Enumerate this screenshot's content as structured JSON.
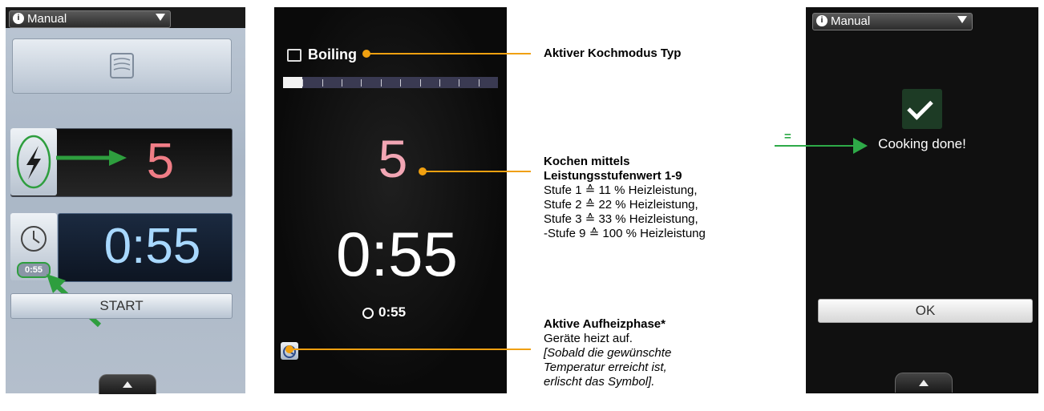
{
  "screen1": {
    "mode_dropdown": {
      "label": "Manual",
      "icon": "info-icon"
    },
    "mode_button_icon": "boiling-mode-icon",
    "power_icon": "lightning-bolt-icon",
    "power_value": "5",
    "clock_icon": "clock-icon",
    "time_value": "0:55",
    "small_time": "0:55",
    "start_label": "START",
    "bottom_tab_icon": "chevron-up-icon"
  },
  "screen2": {
    "mode_label": "Boiling",
    "mode_icon": "boiling-mode-icon",
    "progress_fraction": 0.09,
    "power_value": "5",
    "time_value": "0:55",
    "small_time": "0:55",
    "heat_icon": "heating-phase-icon"
  },
  "annotations": {
    "mode_type": "Aktiver Kochmodus Typ",
    "power_title_1": "Kochen mittels",
    "power_title_2": "Leistungsstufenwert 1-9",
    "power_lines": [
      "Stufe 1 ≙ 11 % Heizleistung,",
      "Stufe 2 ≙ 22 % Heizleistung,",
      "Stufe 3 ≙ 33 % Heizleistung,",
      "-Stufe 9 ≙ 100 % Heizleistung"
    ],
    "heat_title": "Aktive Aufheizphase*",
    "heat_lines": [
      "Geräte heizt auf.",
      "[Sobald die gewünschte",
      "Temperatur erreicht ist,",
      "erlischt das Symbol]."
    ],
    "equals": "="
  },
  "screen3": {
    "mode_dropdown": {
      "label": "Manual",
      "icon": "info-icon"
    },
    "check_icon": "checkmark-icon",
    "message": "Cooking done!",
    "ok_label": "OK",
    "bottom_tab_icon": "chevron-up-icon"
  },
  "colors": {
    "annotation_orange": "#f0a010",
    "highlight_green": "#2eaa48",
    "power_red": "#f07d86",
    "time_blue": "#a8d8ff"
  }
}
